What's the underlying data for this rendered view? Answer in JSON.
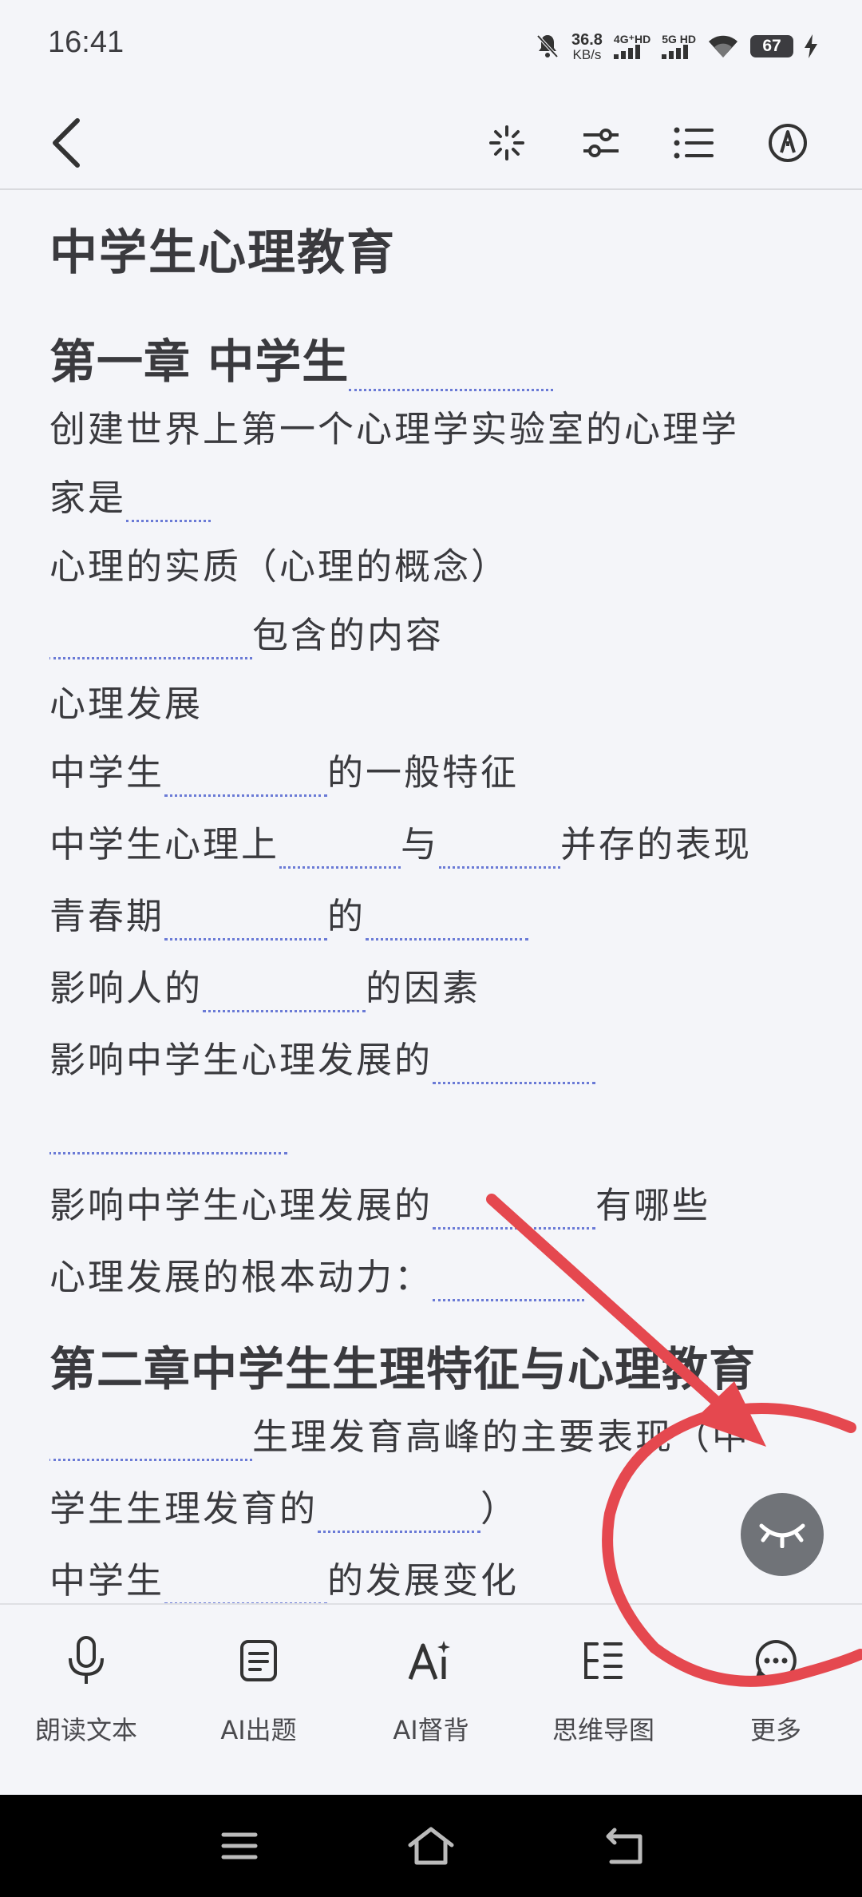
{
  "status_bar": {
    "time": "16:41",
    "net_speed_value": "36.8",
    "net_speed_unit": "KB/s",
    "sim1": "4G⁺HD",
    "sim2": "5G HD",
    "battery": "67",
    "icons": [
      "mute-bell-icon",
      "signal-icon",
      "wifi-icon",
      "battery-icon",
      "charging-icon"
    ]
  },
  "toolbar": {
    "icons": [
      "back-icon",
      "sparkle-icon",
      "sliders-icon",
      "list-icon",
      "pen-icon"
    ]
  },
  "document": {
    "title": "中学生心理教育",
    "chapter1": "第一章 中学生",
    "lines": [
      {
        "before": "创建世界上第一个心理学实验室的心理学",
        "after": ""
      },
      {
        "before": "家是",
        "after": ""
      },
      {
        "before": "心理的实质（心理的概念）",
        "after": ""
      },
      {
        "before": "",
        "after": "包含的内容"
      },
      {
        "before": "心理发展",
        "after": ""
      },
      {
        "before": "中学生",
        "after": "的一般特征"
      },
      {
        "before": "中学生心理上",
        "mid": "与",
        "after": "并存的表现"
      },
      {
        "before": "青春期",
        "mid": "的",
        "after": ""
      },
      {
        "before": "影响人的",
        "after": "的因素"
      },
      {
        "before": "影响中学生心理发展的",
        "after": ""
      },
      {
        "before": "",
        "after": ""
      },
      {
        "before": "影响中学生心理发展的",
        "after": "有哪些"
      },
      {
        "before": "心理发展的根本动力：",
        "after": ""
      }
    ],
    "chapter2": "第二章中学生生理特征与心理教育",
    "lines2": [
      {
        "before": "",
        "after": "生理发育高峰的主要表现（中"
      },
      {
        "before": "学生生理发育的",
        "after": "）"
      },
      {
        "before": "中学生",
        "after": "的发展变化"
      }
    ]
  },
  "fab": {
    "icon": "eye-closed-icon"
  },
  "bottom_bar": {
    "items": [
      {
        "label": "朗读文本",
        "icon": "microphone-icon"
      },
      {
        "label": "AI出题",
        "icon": "document-icon"
      },
      {
        "label": "AI督背",
        "icon": "ai-icon"
      },
      {
        "label": "思维导图",
        "icon": "mindmap-icon"
      },
      {
        "label": "更多",
        "icon": "more-icon"
      }
    ]
  },
  "nav_bar": {
    "icons": [
      "menu-icon",
      "home-icon",
      "back-nav-icon"
    ]
  },
  "colors": {
    "background": "#f4f5f9",
    "blank_underline": "#6a7ad6",
    "annotation_red": "#e5484f",
    "fab": "#707378"
  }
}
